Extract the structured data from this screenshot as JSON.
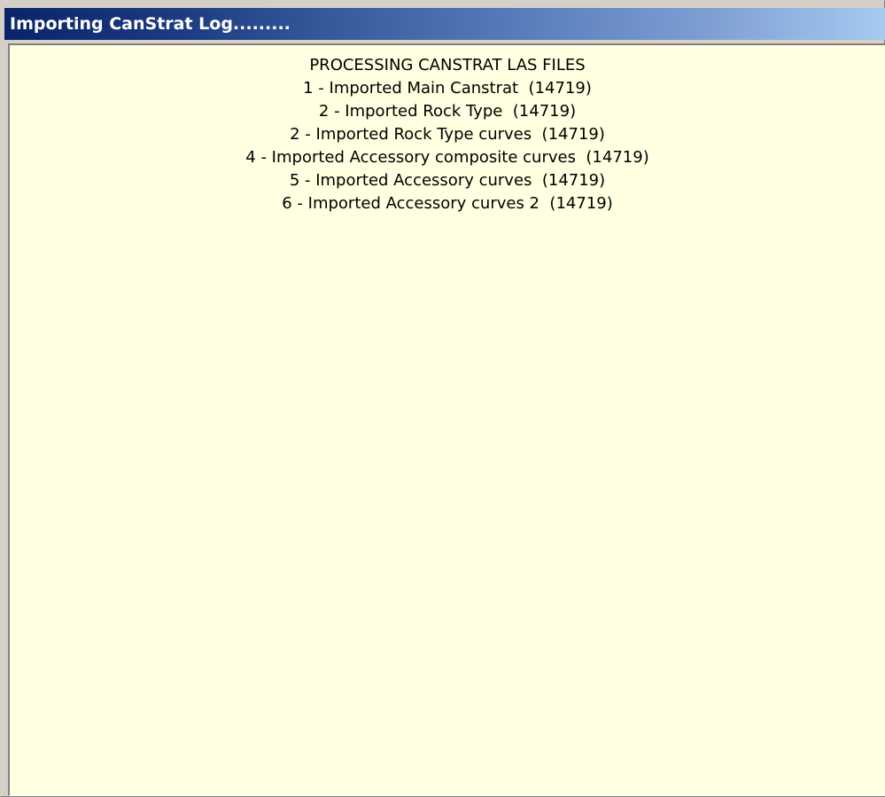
{
  "window": {
    "title": "Importing CanStrat Log........."
  },
  "log": {
    "lines": [
      "PROCESSING CANSTRAT LAS FILES",
      "1 - Imported Main Canstrat  (14719)",
      "2 - Imported Rock Type  (14719)",
      "2 - Imported Rock Type curves  (14719)",
      "4 - Imported Accessory composite curves  (14719)",
      "5 - Imported Accessory curves  (14719)",
      "6 - Imported Accessory curves 2  (14719)"
    ]
  },
  "colors": {
    "titlebar_start": "#0a246a",
    "titlebar_end": "#a6caf0",
    "log_background": "#ffffe1",
    "window_face": "#d4d0c8"
  }
}
